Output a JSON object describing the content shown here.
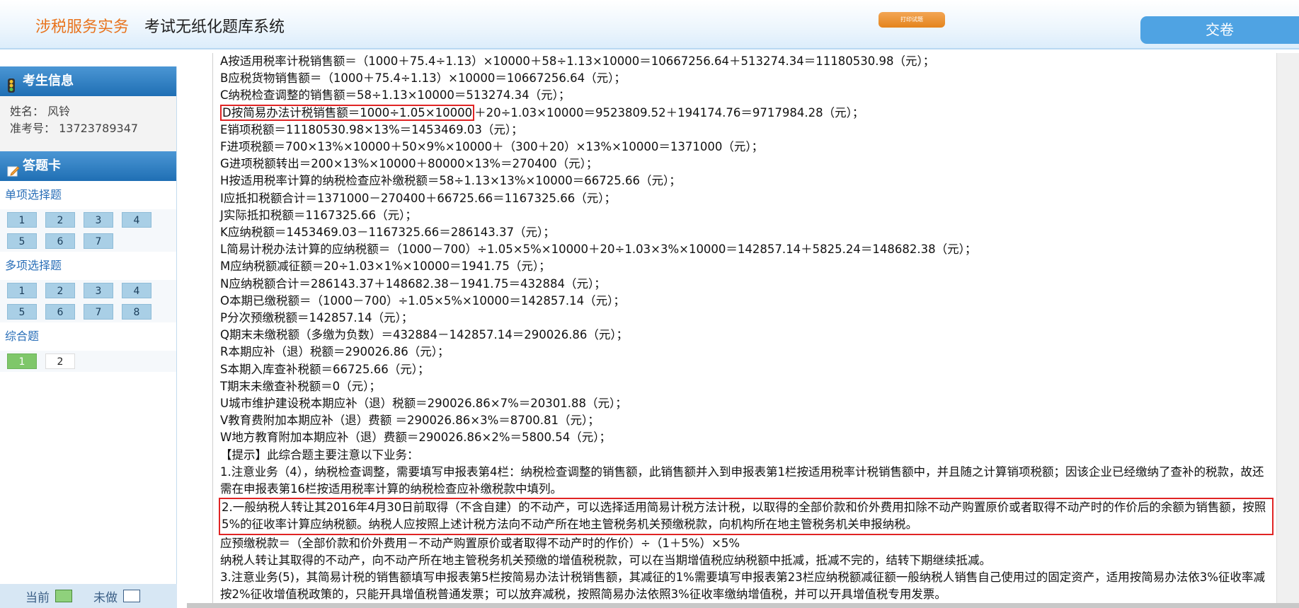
{
  "header": {
    "brand": "涉税服务实务",
    "system_title": "考试无纸化题库系统",
    "print_label": "打印试题",
    "submit_label": "交卷"
  },
  "sidebar": {
    "student_info_title": "考生信息",
    "name_line": "姓名：  风铃",
    "exam_id_line": "准考号：  13723789347",
    "answer_card_title": "答题卡",
    "sections": [
      {
        "title": "单项选择题",
        "rows": [
          [
            "1",
            "2",
            "3",
            "4"
          ],
          [
            "5",
            "6",
            "7"
          ]
        ]
      },
      {
        "title": "多项选择题",
        "rows": [
          [
            "1",
            "2",
            "3",
            "4"
          ],
          [
            "5",
            "6",
            "7",
            "8"
          ]
        ]
      },
      {
        "title": "综合题",
        "rows": [
          [
            "1",
            "2"
          ]
        ]
      }
    ],
    "legend": {
      "current": "当前",
      "undone": "未做"
    }
  },
  "content": {
    "lines": [
      "A按适用税率计税销售额＝（1000＋75.4÷1.13）×10000＋58÷1.13×10000＝10667256.64＋513274.34＝11180530.98（元）；",
      "B应税货物销售额＝（1000＋75.4÷1.13）×10000＝10667256.64（元）；",
      "C纳税检查调整的销售额＝58÷1.13×10000＝513274.34（元）；",
      "",
      "E销项税额＝11180530.98×13%＝1453469.03（元）；",
      "F进项税额＝700×13%×10000＋50×9%×10000＋（300＋20）×13%×10000＝1371000（元）；",
      "G进项税额转出＝200×13%×10000＋80000×13%＝270400（元）；",
      "H按适用税率计算的纳税检查应补缴税额＝58÷1.13×13%×10000＝66725.66（元）；",
      "I应抵扣税额合计＝1371000－270400＋66725.66＝1167325.66（元）；",
      "J实际抵扣税额＝1167325.66（元）；",
      "K应纳税额＝1453469.03－1167325.66＝286143.37（元）；",
      "L简易计税办法计算的应纳税额＝（1000－700）÷1.05×5%×10000＋20÷1.03×3%×10000＝142857.14＋5825.24＝148682.38（元）；",
      "M应纳税额减征额＝20÷1.03×1%×10000＝1941.75（元）；",
      "N应纳税额合计＝286143.37＋148682.38－1941.75＝432884（元）；",
      "O本期已缴税额＝（1000－700）÷1.05×5%×10000＝142857.14（元）；",
      "P分次预缴税额＝142857.14（元）；",
      "Q期末未缴税额（多缴为负数）＝432884－142857.14＝290026.86（元）；",
      "R本期应补（退）税额＝290026.86（元）；",
      "S本期入库查补税额＝66725.66（元）；",
      "T期末未缴查补税额＝0（元）；",
      "U城市维护建设税本期应补（退）税额＝290026.86×7%＝20301.88（元）；",
      "V教育费附加本期应补（退）费额 ＝290026.86×3%＝8700.81（元）；",
      "W地方教育附加本期应补（退）费额＝290026.86×2%＝5800.54（元）；",
      "【提示】此综合题主要注意以下业务："
    ],
    "line_d_part1": "D按简易办法计税销售额＝1000÷1.05×10000",
    "line_d_part2": "＋20÷1.03×10000＝9523809.52＋194174.76＝9717984.28（元）；",
    "note1": "1.注意业务（4），纳税检查调整，需要填写申报表第4栏：纳税检查调整的销售额，此销售额并入到申报表第1栏按适用税率计税销售额中，并且随之计算销项税额；因该企业已经缴纳了查补的税款，故还需在申报表第16栏按适用税率计算的纳税检查应补缴税款中填列。",
    "note2": "2.一般纳税人转让其2016年4月30日前取得（不含自建）的不动产，可以选择适用简易计税方法计税，以取得的全部价款和价外费用扣除不动产购置原价或者取得不动产时的作价后的余额为销售额，按照5%的征收率计算应纳税额。纳税人应按照上述计税方法向不动产所在地主管税务机关预缴税款，向机构所在地主管税务机关申报纳税。",
    "formula": "应预缴税款＝（全部价款和价外费用－不动产购置原价或者取得不动产时的作价）÷（1＋5%）×5%",
    "note_deduct": "纳税人转让其取得的不动产，向不动产所在地主管税务机关预缴的增值税税款，可以在当期增值税应纳税额中抵减，抵减不完的，结转下期继续抵减。",
    "note3": "3.注意业务(5)，其简易计税的销售额填写申报表第5栏按简易办法计税销售额，其减征的1%需要填写申报表第23栏应纳税额减征额一般纳税人销售自己使用过的固定资产，适用按简易办法依3%征收率减按2%征收增值税政策的，只能开具增值税普通发票；可以放弃减税，按照简易办法依照3%征收率缴纳增值税，并可以开具增值税专用发票。"
  },
  "colors": {
    "brand": "#e8741e",
    "submit_bg": "#4fa3e3",
    "panel_head": "#1f6fb4",
    "highlight_border": "#e02424",
    "current_green": "#7fc76a"
  }
}
